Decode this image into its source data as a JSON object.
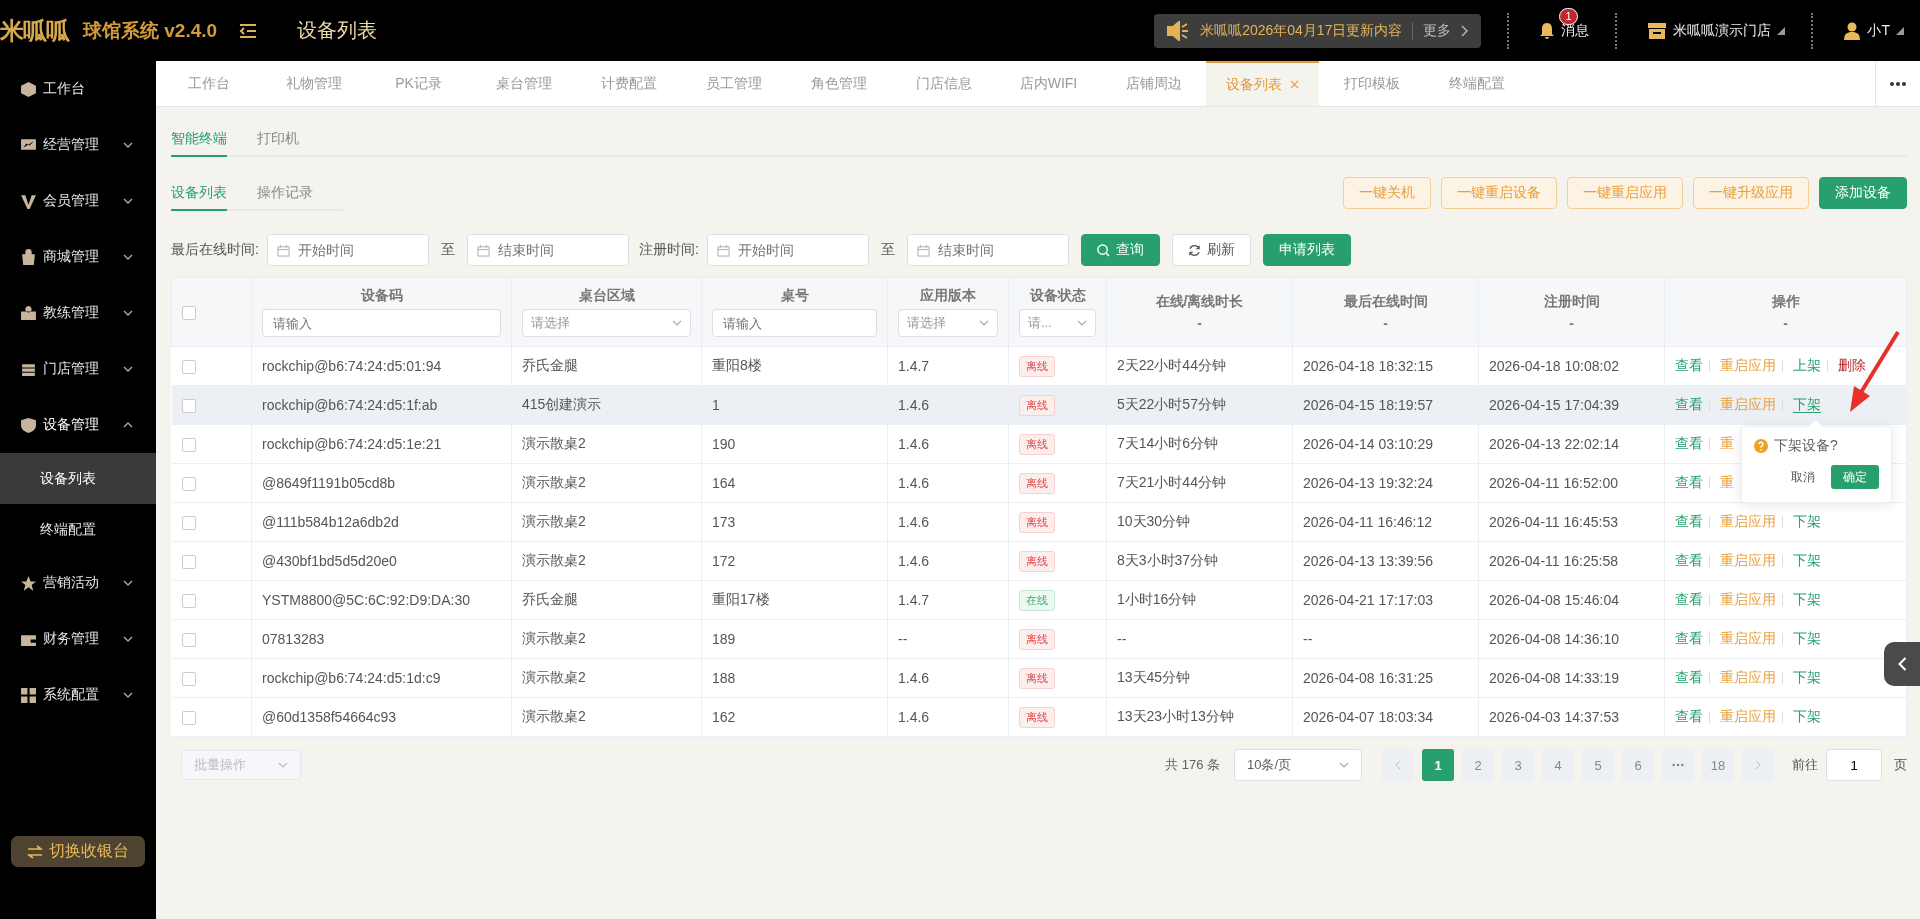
{
  "topbar": {
    "logo": "米呱呱",
    "app_title": "球馆系统 v2.4.0",
    "page_title": "设备列表",
    "notice": "米呱呱2026年04月17日更新内容",
    "notice_more": "更多",
    "messages_label": "消息",
    "messages_badge": "1",
    "store": "米呱呱演示门店",
    "user": "小T"
  },
  "sidebar": {
    "items": [
      {
        "label": "工作台"
      },
      {
        "label": "经营管理",
        "expanded": false
      },
      {
        "label": "会员管理",
        "expanded": false
      },
      {
        "label": "商城管理",
        "expanded": false
      },
      {
        "label": "教练管理",
        "expanded": false
      },
      {
        "label": "门店管理",
        "expanded": false
      },
      {
        "label": "设备管理",
        "expanded": true,
        "children": [
          {
            "label": "设备列表",
            "selected": true
          },
          {
            "label": "终端配置",
            "selected": false
          }
        ]
      },
      {
        "label": "营销活动",
        "expanded": false
      },
      {
        "label": "财务管理",
        "expanded": false
      },
      {
        "label": "系统配置",
        "expanded": false
      }
    ],
    "switch_button": "切换收银台"
  },
  "tabs": [
    {
      "label": "工作台",
      "selected": false
    },
    {
      "label": "礼物管理",
      "selected": false
    },
    {
      "label": "PK记录",
      "selected": false
    },
    {
      "label": "桌台管理",
      "selected": false
    },
    {
      "label": "计费配置",
      "selected": false
    },
    {
      "label": "员工管理",
      "selected": false
    },
    {
      "label": "角色管理",
      "selected": false
    },
    {
      "label": "门店信息",
      "selected": false
    },
    {
      "label": "店内WIFI",
      "selected": false
    },
    {
      "label": "店铺周边",
      "selected": false
    },
    {
      "label": "设备列表",
      "selected": true
    },
    {
      "label": "打印模板",
      "selected": false
    },
    {
      "label": "终端配置",
      "selected": false
    }
  ],
  "sub_tabs": [
    {
      "label": "智能终端",
      "selected": true
    },
    {
      "label": "打印机",
      "selected": false
    }
  ],
  "list_tabs": [
    {
      "label": "设备列表",
      "selected": true
    },
    {
      "label": "操作记录",
      "selected": false
    }
  ],
  "actions": [
    {
      "label": "一键关机",
      "kind": "outline"
    },
    {
      "label": "一键重启设备",
      "kind": "outline"
    },
    {
      "label": "一键重启应用",
      "kind": "outline"
    },
    {
      "label": "一键升级应用",
      "kind": "outline"
    },
    {
      "label": "添加设备",
      "kind": "primary"
    }
  ],
  "filters": {
    "last_online_label": "最后在线时间:",
    "register_label": "注册时间:",
    "ranges": [
      {
        "start_placeholder": "开始时间",
        "sep": "至",
        "end_placeholder": "结束时间"
      },
      {
        "start_placeholder": "开始时间",
        "sep": "至",
        "end_placeholder": "结束时间"
      }
    ],
    "buttons": [
      {
        "label": "查询",
        "kind": "search"
      },
      {
        "label": "刷新",
        "kind": "refresh"
      },
      {
        "label": "申请列表",
        "kind": "primary"
      }
    ]
  },
  "table": {
    "select_all_checked": false,
    "columns": [
      {
        "title": "设备码",
        "filter": {
          "kind": "input",
          "placeholder": "请输入"
        }
      },
      {
        "title": "桌台区域",
        "filter": {
          "kind": "select",
          "placeholder": "请选择"
        }
      },
      {
        "title": "桌号",
        "filter": {
          "kind": "input",
          "placeholder": "请输入"
        }
      },
      {
        "title": "应用版本",
        "filter": {
          "kind": "select",
          "placeholder": "请选择"
        }
      },
      {
        "title": "设备状态",
        "filter": {
          "kind": "select",
          "placeholder": "请..."
        }
      },
      {
        "title": "在线/离线时长",
        "sub": "-"
      },
      {
        "title": "最后在线时间",
        "sub": "-"
      },
      {
        "title": "注册时间",
        "sub": "-"
      },
      {
        "title": "操作",
        "sub": "-"
      }
    ],
    "rows": [
      {
        "checked": false,
        "highlighted": false,
        "code": "rockchip@b6:74:24:d5:01:94",
        "area": "乔氏金腿",
        "table_no": "重阳8楼",
        "version": "1.4.7",
        "status": {
          "label": "离线",
          "kind": "offline"
        },
        "duration": "2天22小时44分钟",
        "last_online": "2026-04-18 18:32:15",
        "registered": "2026-04-18 10:08:02",
        "ops": [
          {
            "label": "查看",
            "kind": "view",
            "active": false
          },
          {
            "label": "重启应用",
            "kind": "restart",
            "active": false
          },
          {
            "label": "上架",
            "kind": "shelve",
            "active": false
          },
          {
            "label": "删除",
            "kind": "delete",
            "active": false
          }
        ]
      },
      {
        "checked": false,
        "highlighted": true,
        "code": "rockchip@b6:74:24:d5:1f:ab",
        "area": "415创建演示",
        "table_no": "1",
        "version": "1.4.6",
        "status": {
          "label": "离线",
          "kind": "offline"
        },
        "duration": "5天22小时57分钟",
        "last_online": "2026-04-15 18:19:57",
        "registered": "2026-04-15 17:04:39",
        "ops": [
          {
            "label": "查看",
            "kind": "view",
            "active": false
          },
          {
            "label": "重启应用",
            "kind": "restart",
            "active": false
          },
          {
            "label": "下架",
            "kind": "shelve",
            "active": true
          }
        ]
      },
      {
        "checked": false,
        "highlighted": false,
        "code": "rockchip@b6:74:24:d5:1e:21",
        "area": "演示散桌2",
        "table_no": "190",
        "version": "1.4.6",
        "status": {
          "label": "离线",
          "kind": "offline"
        },
        "duration": "7天14小时6分钟",
        "last_online": "2026-04-14 03:10:29",
        "registered": "2026-04-13 22:02:14",
        "ops": [
          {
            "label": "查看",
            "kind": "view",
            "active": false
          },
          {
            "label": "重",
            "kind": "restart",
            "active": false
          }
        ]
      },
      {
        "checked": false,
        "highlighted": false,
        "code": "@8649f1191b05cd8b",
        "area": "演示散桌2",
        "table_no": "164",
        "version": "1.4.6",
        "status": {
          "label": "离线",
          "kind": "offline"
        },
        "duration": "7天21小时44分钟",
        "last_online": "2026-04-13 19:32:24",
        "registered": "2026-04-11 16:52:00",
        "ops": [
          {
            "label": "查看",
            "kind": "view",
            "active": false
          },
          {
            "label": "重",
            "kind": "restart",
            "active": false
          }
        ]
      },
      {
        "checked": false,
        "highlighted": false,
        "code": "@111b584b12a6db2d",
        "area": "演示散桌2",
        "table_no": "173",
        "version": "1.4.6",
        "status": {
          "label": "离线",
          "kind": "offline"
        },
        "duration": "10天30分钟",
        "last_online": "2026-04-11 16:46:12",
        "registered": "2026-04-11 16:45:53",
        "ops": [
          {
            "label": "查看",
            "kind": "view",
            "active": false
          },
          {
            "label": "重启应用",
            "kind": "restart",
            "active": false
          },
          {
            "label": "下架",
            "kind": "shelve",
            "active": false
          }
        ]
      },
      {
        "checked": false,
        "highlighted": false,
        "code": "@430bf1bd5d5d20e0",
        "area": "演示散桌2",
        "table_no": "172",
        "version": "1.4.6",
        "status": {
          "label": "离线",
          "kind": "offline"
        },
        "duration": "8天3小时37分钟",
        "last_online": "2026-04-13 13:39:56",
        "registered": "2026-04-11 16:25:58",
        "ops": [
          {
            "label": "查看",
            "kind": "view",
            "active": false
          },
          {
            "label": "重启应用",
            "kind": "restart",
            "active": false
          },
          {
            "label": "下架",
            "kind": "shelve",
            "active": false
          }
        ]
      },
      {
        "checked": false,
        "highlighted": false,
        "code": "YSTM8800@5C:6C:92:D9:DA:30",
        "area": "乔氏金腿",
        "table_no": "重阳17楼",
        "version": "1.4.7",
        "status": {
          "label": "在线",
          "kind": "online"
        },
        "duration": "1小时16分钟",
        "last_online": "2026-04-21 17:17:03",
        "registered": "2026-04-08 15:46:04",
        "ops": [
          {
            "label": "查看",
            "kind": "view",
            "active": false
          },
          {
            "label": "重启应用",
            "kind": "restart",
            "active": false
          },
          {
            "label": "下架",
            "kind": "shelve",
            "active": false
          }
        ]
      },
      {
        "checked": false,
        "highlighted": false,
        "code": "07813283",
        "area": "演示散桌2",
        "table_no": "189",
        "version": "--",
        "status": {
          "label": "离线",
          "kind": "offline"
        },
        "duration": "--",
        "last_online": "--",
        "registered": "2026-04-08 14:36:10",
        "ops": [
          {
            "label": "查看",
            "kind": "view",
            "active": false
          },
          {
            "label": "重启应用",
            "kind": "restart",
            "active": false
          },
          {
            "label": "下架",
            "kind": "shelve",
            "active": false
          }
        ]
      },
      {
        "checked": false,
        "highlighted": false,
        "code": "rockchip@b6:74:24:d5:1d:c9",
        "area": "演示散桌2",
        "table_no": "188",
        "version": "1.4.6",
        "status": {
          "label": "离线",
          "kind": "offline"
        },
        "duration": "13天45分钟",
        "last_online": "2026-04-08 16:31:25",
        "registered": "2026-04-08 14:33:19",
        "ops": [
          {
            "label": "查看",
            "kind": "view",
            "active": false
          },
          {
            "label": "重启应用",
            "kind": "restart",
            "active": false
          },
          {
            "label": "下架",
            "kind": "shelve",
            "active": false
          }
        ]
      },
      {
        "checked": false,
        "highlighted": false,
        "code": "@60d1358f54664c93",
        "area": "演示散桌2",
        "table_no": "162",
        "version": "1.4.6",
        "status": {
          "label": "离线",
          "kind": "offline"
        },
        "duration": "13天23小时13分钟",
        "last_online": "2026-04-07 18:03:34",
        "registered": "2026-04-03 14:37:53",
        "ops": [
          {
            "label": "查看",
            "kind": "view",
            "active": false
          },
          {
            "label": "重启应用",
            "kind": "restart",
            "active": false
          },
          {
            "label": "下架",
            "kind": "shelve",
            "active": false
          }
        ]
      }
    ]
  },
  "popconfirm": {
    "title": "下架设备?",
    "cancel": "取消",
    "confirm": "确定"
  },
  "footer": {
    "batch_placeholder": "批量操作",
    "total": "共 176 条",
    "page_size": "10条/页",
    "pages": [
      {
        "label": "1",
        "selected": true
      },
      {
        "label": "2",
        "selected": false
      },
      {
        "label": "3",
        "selected": false
      },
      {
        "label": "4",
        "selected": false
      },
      {
        "label": "5",
        "selected": false
      },
      {
        "label": "6",
        "selected": false
      }
    ],
    "last_page": "18",
    "goto_label": "前往",
    "goto_value": "1",
    "goto_suffix": "页"
  }
}
